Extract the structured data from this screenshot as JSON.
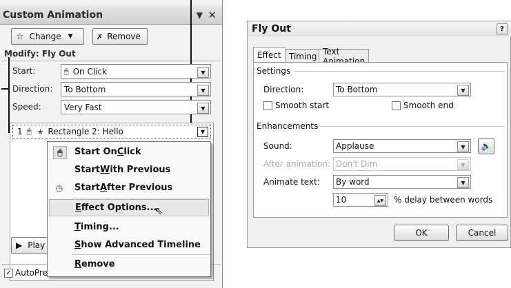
{
  "task_pane": {
    "title": "Custom Animation",
    "change_label": "Change",
    "remove_label": "Remove",
    "modify_heading": "Modify: Fly Out",
    "start_label": "Start:",
    "start_value": "On Click",
    "direction_label": "Direction:",
    "direction_value": "To Bottom",
    "speed_label": "Speed:",
    "speed_value": "Very Fast",
    "list_item": {
      "order": "1",
      "name": "Rectangle 2: Hello"
    },
    "play_label": "Play",
    "autopreview_label": "AutoPreview"
  },
  "context_menu": {
    "items": [
      {
        "pre": "Start On ",
        "key": "C",
        "post": "lick",
        "icon": "mouse-click-icon"
      },
      {
        "pre": "Start ",
        "key": "W",
        "post": "ith Previous",
        "icon": ""
      },
      {
        "pre": "Start ",
        "key": "A",
        "post": "fter Previous",
        "icon": "clock-icon"
      },
      {
        "pre": "",
        "key": "E",
        "post": "ffect Options...",
        "icon": ""
      },
      {
        "pre": "",
        "key": "T",
        "post": "iming...",
        "icon": ""
      },
      {
        "pre": "",
        "key": "S",
        "post": "how Advanced Timeline",
        "icon": ""
      },
      {
        "pre": "",
        "key": "R",
        "post": "emove",
        "icon": ""
      }
    ]
  },
  "dialog": {
    "title": "Fly Out",
    "tabs": [
      "Effect",
      "Timing",
      "Text Animation"
    ],
    "settings_heading": "Settings",
    "direction_label": "Direction:",
    "direction_value": "To Bottom",
    "smooth_start_label": "Smooth start",
    "smooth_end_label": "Smooth end",
    "enhancements_heading": "Enhancements",
    "sound_label": "Sound:",
    "sound_value": "Applause",
    "after_animation_label": "After animation:",
    "after_animation_value": "Don't Dim",
    "animate_text_label": "Animate text:",
    "animate_text_value": "By word",
    "delay_value": "10",
    "delay_label": "% delay between words",
    "ok_label": "OK",
    "cancel_label": "Cancel"
  }
}
